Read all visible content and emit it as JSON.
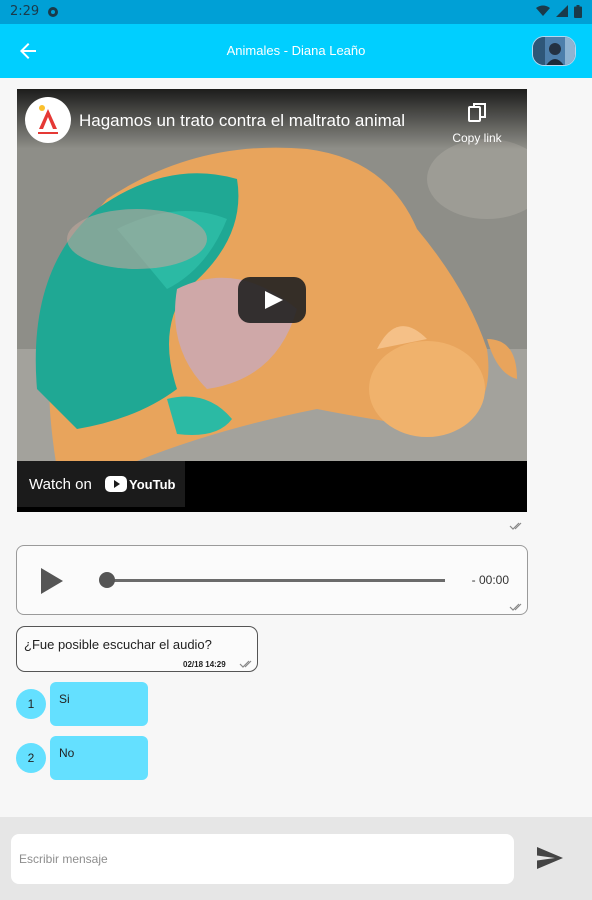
{
  "status_bar": {
    "time": "2:29",
    "icons": [
      "notification-icon",
      "wifi-icon",
      "signal-icon",
      "battery-icon"
    ]
  },
  "app_bar": {
    "title": "Animales - Diana Leaño",
    "back_icon": "arrow-left-icon",
    "avatar": "user-avatar"
  },
  "video": {
    "title": "Hagamos un trato contra el maltrato animal",
    "copy_link_label": "Copy link",
    "watch_on_label": "Watch on",
    "platform_label": "YouTube"
  },
  "audio_player": {
    "time": "- 00:00",
    "progress": 0
  },
  "question": {
    "text": "¿Fue posible escuchar el audio?",
    "timestamp": "02/18 14:29"
  },
  "options": [
    {
      "number": "1",
      "label": "Si"
    },
    {
      "number": "2",
      "label": "No"
    }
  ],
  "composer": {
    "placeholder": "Escribir mensaje",
    "send_icon": "send-icon"
  },
  "colors": {
    "status_bar": "#00a0d6",
    "app_bar": "#00cfff",
    "option_bubble": "#64e0ff",
    "composer_bg": "#e6e6e6"
  }
}
